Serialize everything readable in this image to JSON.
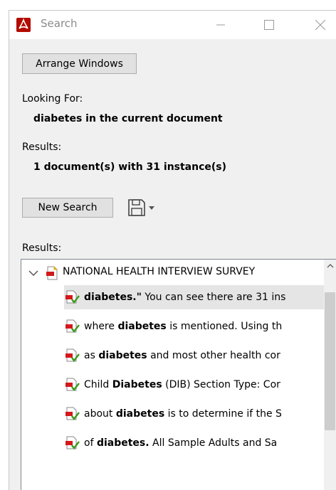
{
  "window": {
    "title": "Search",
    "icon": "acrobat-icon",
    "controls": [
      "minimize-icon",
      "maximize-icon",
      "close-icon"
    ]
  },
  "arrange_button": "Arrange Windows",
  "looking_for": {
    "label": "Looking For:",
    "value": "diabetes in the current document"
  },
  "summary": {
    "label": "Results:",
    "value": "1 document(s) with 31 instance(s)"
  },
  "new_search_button": "New Search",
  "save_icon": "save-icon",
  "results": {
    "label": "Results:",
    "document": "NATIONAL HEALTH INTERVIEW SURVEY",
    "items": [
      {
        "before": "",
        "term": "diabetes.\"",
        "after": " You can see there are 31 ins",
        "selected": true
      },
      {
        "before": "where ",
        "term": "diabetes",
        "after": " is mentioned. Using th",
        "selected": false
      },
      {
        "before": "as ",
        "term": "diabetes",
        "after": " and most other health cor",
        "selected": false
      },
      {
        "before": "Child ",
        "term": "Diabetes",
        "after": " (DIB) Section Type: Cor",
        "selected": false
      },
      {
        "before": "about ",
        "term": "diabetes",
        "after": " is to determine if the S",
        "selected": false
      },
      {
        "before": "of ",
        "term": "diabetes.",
        "after": " All Sample Adults and Sa",
        "selected": false
      }
    ]
  },
  "colors": {
    "window_bg": "#f0f0f0",
    "button_bg": "#e1e1e1",
    "selected_row": "#e5e5e5",
    "acrobat_red": "#b30b00"
  }
}
